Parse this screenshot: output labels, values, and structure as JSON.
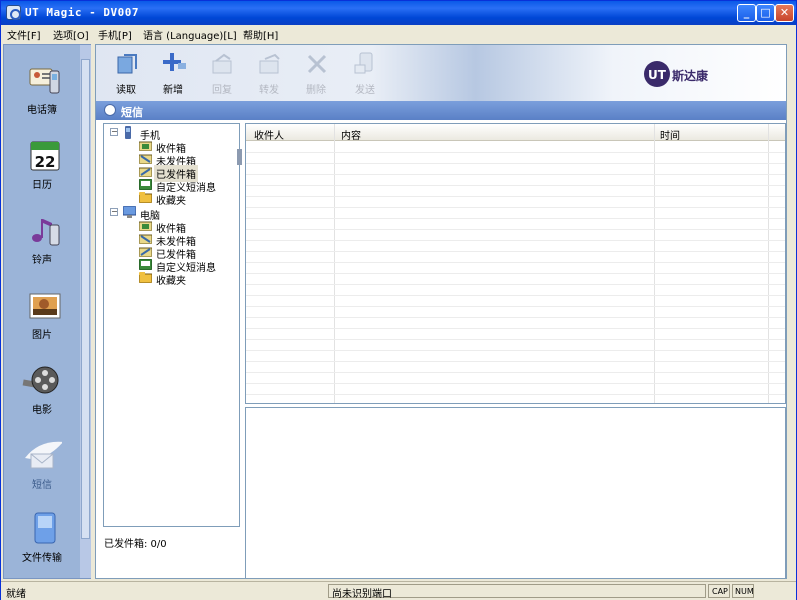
{
  "window": {
    "title": "UT Magic - DV007"
  },
  "menu": [
    "文件[F]",
    "选项[O]",
    "手机[P]",
    "语言 (Language)[L]",
    "帮助[H]"
  ],
  "sidebar": [
    {
      "label": "电话簿",
      "icon": "phonebook-icon"
    },
    {
      "label": "日历",
      "icon": "calendar-icon"
    },
    {
      "label": "铃声",
      "icon": "ringtone-icon"
    },
    {
      "label": "图片",
      "icon": "picture-icon"
    },
    {
      "label": "电影",
      "icon": "movie-icon"
    },
    {
      "label": "短信",
      "icon": "sms-icon"
    },
    {
      "label": "文件传输",
      "icon": "file-transfer-icon"
    }
  ],
  "toolbar": {
    "items": [
      {
        "label": "读取",
        "enabled": true
      },
      {
        "label": "新增",
        "enabled": true
      },
      {
        "label": "回复",
        "enabled": false
      },
      {
        "label": "转发",
        "enabled": false
      },
      {
        "label": "删除",
        "enabled": false
      },
      {
        "label": "发送",
        "enabled": false
      }
    ],
    "logo": "斯达康"
  },
  "section": {
    "title": "短信"
  },
  "tree": {
    "phone": {
      "label": "手机",
      "children": [
        "收件箱",
        "未发件箱",
        "已发件箱",
        "自定义短消息",
        "收藏夹"
      ]
    },
    "computer": {
      "label": "电脑",
      "children": [
        "收件箱",
        "未发件箱",
        "已发件箱",
        "自定义短消息",
        "收藏夹"
      ]
    }
  },
  "folder_status": "已发件箱: 0/0",
  "grid": {
    "columns": [
      "收件人",
      "内容",
      "时间"
    ]
  },
  "status": {
    "left": "就绪",
    "center": "尚未识别端口",
    "caps": "CAP",
    "num": "NUM"
  }
}
